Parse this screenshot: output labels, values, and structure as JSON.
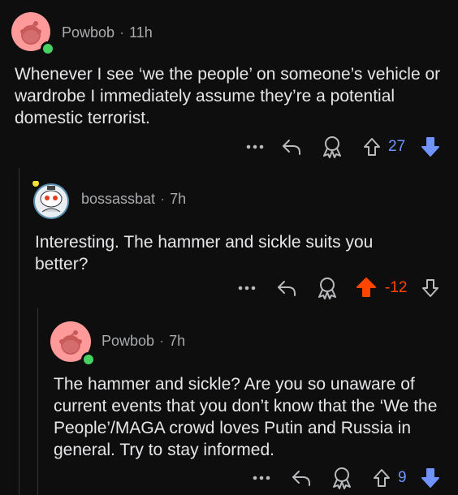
{
  "comments": [
    {
      "author": "Powbob",
      "separator": "·",
      "time": "11h",
      "body": "Whenever I see ‘we the people’ on someone’s vehicle or wardrobe I immediately assume they’re a potential domestic terrorist.",
      "score": "27",
      "vote_state": "downvoted",
      "score_color": "#7193ff",
      "more_label": "•••"
    },
    {
      "author": "bossassbat",
      "separator": "·",
      "time": "7h",
      "body": "Interesting. The hammer and sickle suits you better?",
      "score": "-12",
      "vote_state": "upvoted",
      "score_color": "#ff4500",
      "more_label": "•••"
    },
    {
      "author": "Powbob",
      "separator": "·",
      "time": "7h",
      "body": "The hammer and sickle? Are you so unaware of current events that you don’t know that the ‘We the People’/MAGA crowd loves Putin and Russia in general. Try to stay informed.",
      "score": "9",
      "vote_state": "downvoted",
      "score_color": "#7193ff",
      "more_label": "•••"
    }
  ],
  "icons": {
    "more": "more-options-icon",
    "reply": "reply-icon",
    "award": "award-icon",
    "upvote": "upvote-icon",
    "downvote": "downvote-icon"
  },
  "colors": {
    "background": "#0e0e0f",
    "online": "#46d160",
    "avatar_pink": "#ff9a9a",
    "upvote_active": "#ff4500",
    "downvote_active": "#7193ff"
  }
}
